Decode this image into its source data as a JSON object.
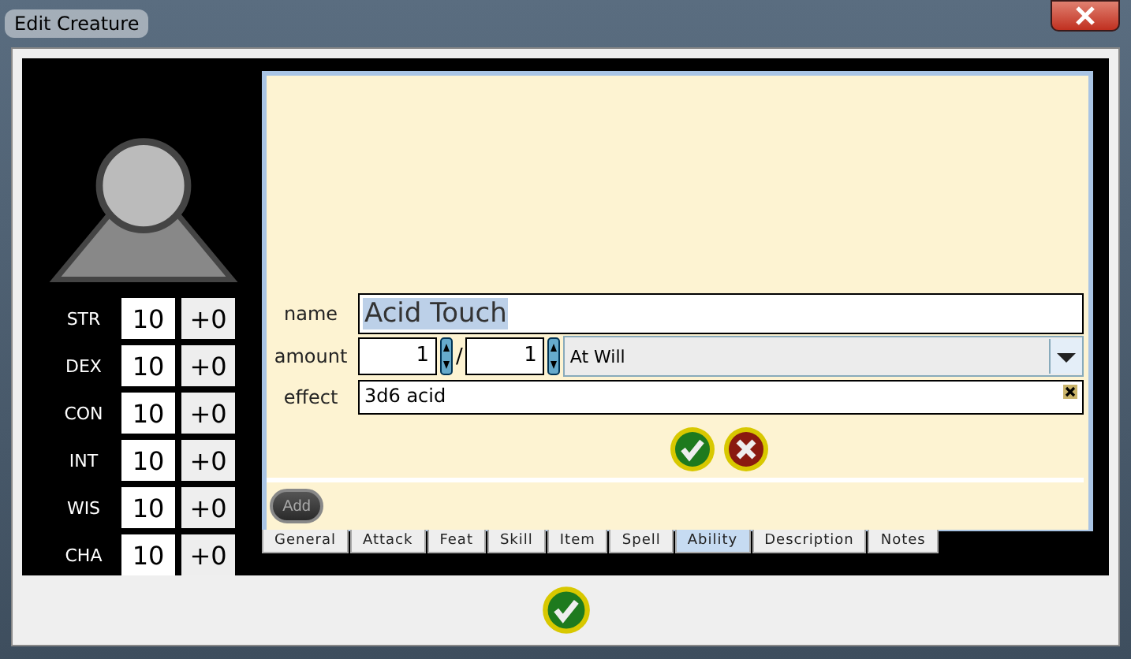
{
  "window": {
    "title": "Edit Creature"
  },
  "stats": [
    {
      "label": "STR",
      "score": "10",
      "modifier": "+0"
    },
    {
      "label": "DEX",
      "score": "10",
      "modifier": "+0"
    },
    {
      "label": "CON",
      "score": "10",
      "modifier": "+0"
    },
    {
      "label": "INT",
      "score": "10",
      "modifier": "+0"
    },
    {
      "label": "WIS",
      "score": "10",
      "modifier": "+0"
    },
    {
      "label": "CHA",
      "score": "10",
      "modifier": "+0"
    }
  ],
  "form": {
    "name_label": "name",
    "name_value": "Acid Touch",
    "amount_label": "amount",
    "amount_used": "1",
    "separator": "/",
    "amount_total": "1",
    "frequency": "At Will",
    "effect_label": "effect",
    "effect_value": "3d6 acid"
  },
  "add_button": {
    "label": "Add",
    "disabled": true
  },
  "tabs": [
    {
      "label": "General",
      "selected": false
    },
    {
      "label": "Attack",
      "selected": false
    },
    {
      "label": "Feat",
      "selected": false
    },
    {
      "label": "Skill",
      "selected": false
    },
    {
      "label": "Item",
      "selected": false
    },
    {
      "label": "Spell",
      "selected": false
    },
    {
      "label": "Ability",
      "selected": true
    },
    {
      "label": "Description",
      "selected": false
    },
    {
      "label": "Notes",
      "selected": false
    }
  ]
}
